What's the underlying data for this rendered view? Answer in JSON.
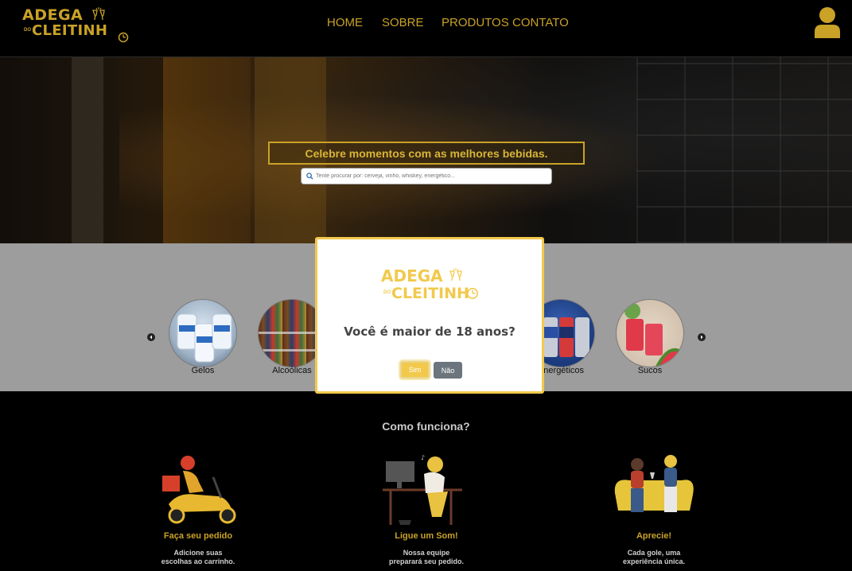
{
  "header": {
    "logo": {
      "line1": "ADEGA",
      "small": "DO",
      "line2": "CLEITINH"
    },
    "nav": [
      {
        "label": "HOME"
      },
      {
        "label": "SOBRE"
      },
      {
        "label": "PRODUTOS"
      },
      {
        "label": "CONTATO"
      }
    ],
    "user_icon": "user-icon",
    "accent_color": "#c9a227"
  },
  "hero": {
    "title": "Celebre momentos com as melhores bebidas.",
    "search_placeholder": "Tente procurar por: cerveja, vinho, whiskey, energético..."
  },
  "categories": {
    "items": [
      {
        "label": "Gelos"
      },
      {
        "label": "Alcoólicas"
      },
      {
        "label": "Energéticos"
      },
      {
        "label": "Sucos"
      }
    ],
    "prev_icon": "chevron-left-icon",
    "next_icon": "chevron-right-icon"
  },
  "how": {
    "title": "Como funciona?",
    "steps": [
      {
        "title": "Faça seu pedido",
        "desc1": "Adicione suas",
        "desc2": "escolhas ao carrinho."
      },
      {
        "title": "Ligue um Som!",
        "desc1": "Nossa equipe",
        "desc2": "preparará seu pedido."
      },
      {
        "title": "Aprecie!",
        "desc1": "Cada gole, uma",
        "desc2": "experiência única."
      }
    ]
  },
  "modal": {
    "logo": {
      "line1": "ADEGA",
      "small": "DO",
      "line2": "CLEITINH"
    },
    "question": "Você é maior de 18 anos?",
    "yes_label": "Sim",
    "no_label": "Não",
    "border_color": "#f2c94c"
  }
}
